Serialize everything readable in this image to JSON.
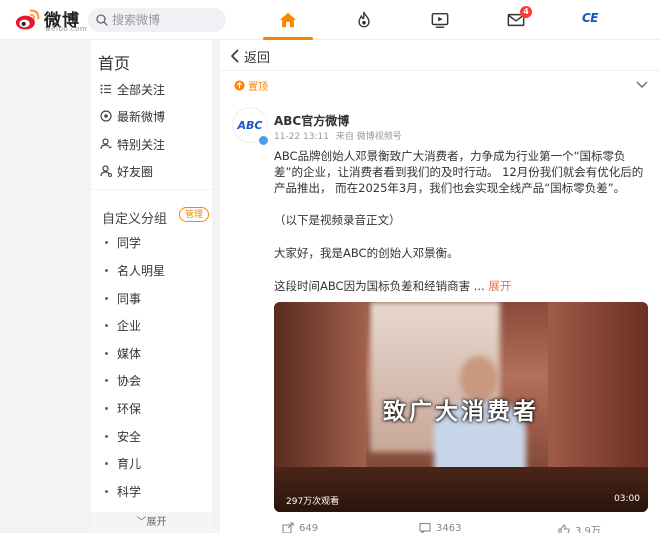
{
  "header": {
    "brand": "微博",
    "brand_sub": "weibo.com",
    "search_placeholder": "搜索微博",
    "nav": [
      {
        "name": "home",
        "icon": "home-icon",
        "active": true
      },
      {
        "name": "hot",
        "icon": "flame-icon"
      },
      {
        "name": "video",
        "icon": "video-icon"
      },
      {
        "name": "messages",
        "icon": "mail-icon",
        "badge": "4"
      },
      {
        "name": "profile",
        "icon": "ce-logo-icon",
        "label": "CE"
      }
    ],
    "accent": "#ff8200"
  },
  "sidebar": {
    "title": "首页",
    "items": [
      {
        "label": "全部关注",
        "icon": "list-icon"
      },
      {
        "label": "最新微博",
        "icon": "clock-icon"
      },
      {
        "label": "特别关注",
        "icon": "user-icon"
      },
      {
        "label": "好友圈",
        "icon": "friends-icon"
      }
    ],
    "custom_title": "自定义分组",
    "manage_label": "管理",
    "groups": [
      "同学",
      "名人明星",
      "同事",
      "企业",
      "媒体",
      "协会",
      "环保",
      "安全",
      "育儿",
      "科学"
    ],
    "expand_label": "展开"
  },
  "main": {
    "back_label": "返回",
    "pinned_label": "置顶",
    "post": {
      "author": "ABC官方微博",
      "avatar_text": "ABC",
      "time": "11-22 13:11",
      "source": "来自 微博视频号",
      "paragraph1": "ABC品牌创始人邓景衡致广大消费者，力争成为行业第一个“国标零负差”的企业，让消费者看到我们的及时行动。 12月份我们就会有优化后的产品推出， 而在2025年3月，我们也会实现全线产品“国标零负差”。",
      "paragraph2": "（以下是视频录音正文）",
      "paragraph3": "大家好，我是ABC的创始人邓景衡。",
      "paragraph4": "这段时间ABC因为国标负差和经销商害 ...",
      "expand_link": "展开",
      "video": {
        "caption": "致广大消费者",
        "views": "297万次观看",
        "duration": "03:00"
      },
      "stats": {
        "reposts": "649",
        "comments": "3463",
        "likes": "3.9万"
      }
    }
  }
}
